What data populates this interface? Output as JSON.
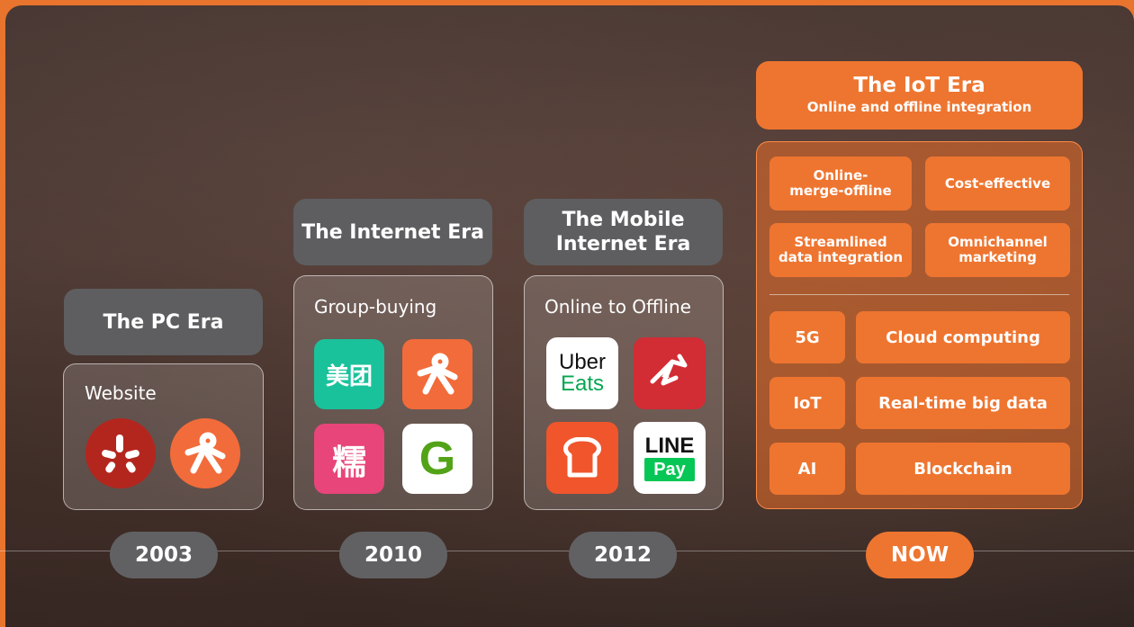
{
  "eras": [
    {
      "title": "The PC Era",
      "caption": "Website",
      "year": "2003",
      "apps": [
        "yelp-icon",
        "dianping-icon"
      ]
    },
    {
      "title": "The Internet Era",
      "caption": "Group-buying",
      "year": "2010",
      "apps": [
        "meituan-icon",
        "dianping-icon",
        "nuomi-icon",
        "groupon-icon"
      ]
    },
    {
      "title": "The Mobile Internet Era",
      "caption": "Online to Offline",
      "year": "2012",
      "apps": [
        "uber-eats-icon",
        "deliveroo-icon",
        "toast-icon",
        "line-pay-icon"
      ]
    }
  ],
  "app_text": {
    "meituan": "美团",
    "nuomi": "糯",
    "groupon": "G",
    "uber": "Uber",
    "eats": "Eats",
    "line": "LINE",
    "pay": "Pay"
  },
  "iot": {
    "title": "The IoT Era",
    "subtitle": "Online and offline integration",
    "year": "NOW",
    "features": [
      "Online-merge-offline",
      "Cost-effective",
      "Streamlined data integration",
      "Omnichannel marketing"
    ],
    "tech_rows": [
      {
        "left": "5G",
        "right": "Cloud computing"
      },
      {
        "left": "IoT",
        "right": "Real-time big data"
      },
      {
        "left": "AI",
        "right": "Blockchain"
      }
    ]
  },
  "colors": {
    "accent": "#ee7530",
    "neutral_pill": "#616163",
    "yelp": "#b3261e",
    "dianping": "#f26b3a",
    "meituan": "#19c29b",
    "nuomi": "#e8457a",
    "groupon": "#53a318",
    "deliveroo": "#d22c35",
    "toast": "#f0552c",
    "line": "#06c755"
  }
}
